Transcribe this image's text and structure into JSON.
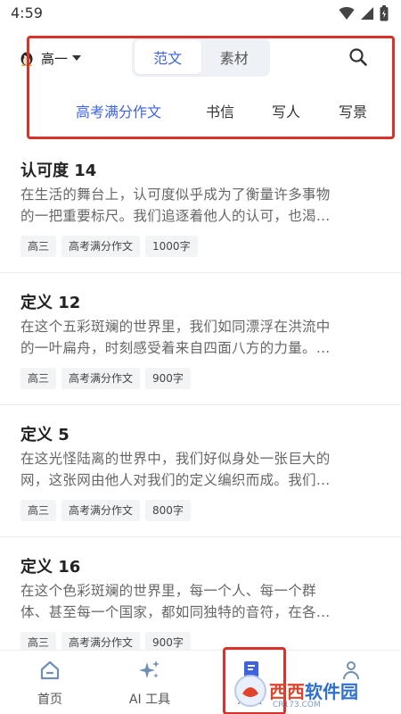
{
  "status_bar": {
    "time": "4:59"
  },
  "header": {
    "grade": "高一",
    "tabs": [
      {
        "label": "范文",
        "active": true
      },
      {
        "label": "素材",
        "active": false
      }
    ],
    "categories": [
      {
        "label": "高考满分作文",
        "active": true
      },
      {
        "label": "书信",
        "active": false
      },
      {
        "label": "写人",
        "active": false
      },
      {
        "label": "写景",
        "active": false
      }
    ]
  },
  "essays": [
    {
      "title": "认可度 14",
      "excerpt_lines": [
        "在生活的舞台上，认可度似乎成为了衡量许多事物",
        "的一把重要标尺。我们追逐着他人的认可，也渴…"
      ],
      "tags": [
        "高三",
        "高考满分作文",
        "1000字"
      ]
    },
    {
      "title": "定义 12",
      "excerpt_lines": [
        "在这个五彩斑斓的世界里，我们如同漂浮在洪流中",
        "的一叶扁舟，时刻感受着来自四面八方的力量。…"
      ],
      "tags": [
        "高三",
        "高考满分作文",
        "900字"
      ]
    },
    {
      "title": "定义 5",
      "excerpt_lines": [
        "在这光怪陆离的世界中，我们好似身处一张巨大的",
        "网，这张网由他人对我们的定义编织而成。我们…"
      ],
      "tags": [
        "高三",
        "高考满分作文",
        "800字"
      ]
    },
    {
      "title": "定义 16",
      "excerpt_lines": [
        "在这个色彩斑斓的世界里，每一个人、每一个群",
        "体、甚至每一个国家，都如同独特的音符，在各…"
      ],
      "tags": [
        "高三",
        "高考满分作文",
        "900字"
      ]
    }
  ],
  "bottom_nav": [
    {
      "label": "首页",
      "icon": "home-icon"
    },
    {
      "label": "AI 工具",
      "icon": "sparkle-icon"
    },
    {
      "label": "范文",
      "icon": "essay-book-icon"
    },
    {
      "label": "",
      "icon": "profile-icon"
    }
  ],
  "watermark": {
    "text": "西西软件园",
    "sub": "CR173.COM"
  },
  "colors": {
    "accent": "#3d63e0",
    "highlight_box": "#d8322b"
  }
}
